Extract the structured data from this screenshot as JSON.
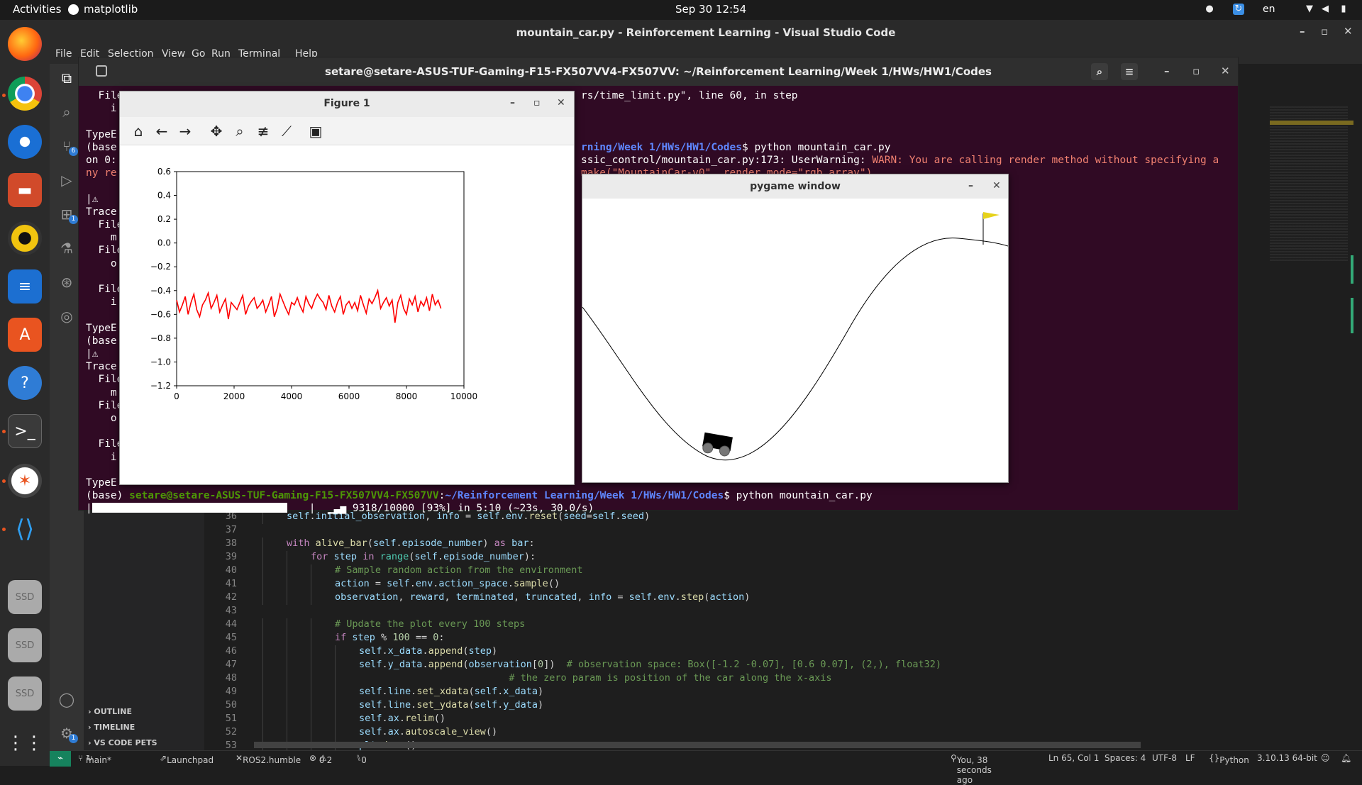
{
  "topbar": {
    "activities": "Activities",
    "app": "matplotlib",
    "clock": "Sep 30  12:54",
    "lang": "en"
  },
  "vscode": {
    "title": "mountain_car.py - Reinforcement Learning - Visual Studio Code",
    "menu": [
      "File",
      "Edit",
      "Selection",
      "View",
      "Go",
      "Run",
      "Terminal",
      "Help"
    ],
    "sidebar": {
      "outline": "OUTLINE",
      "timeline": "TIMELINE",
      "pets": "VS CODE PETS"
    },
    "badges": {
      "scm": "6",
      "ext": "1",
      "settings": "1"
    },
    "lines": [
      {
        "n": "36",
        "indent": 1,
        "html": "<span class='sf'>self</span>.<span class='sf'>initial_observation</span>, <span class='sf'>info</span> = <span class='sf'>self</span>.<span class='sf'>env</span>.<span class='fn'>reset</span>(<span class='sf'>seed</span>=<span class='sf'>self</span>.<span class='sf'>seed</span>)"
      },
      {
        "n": "37",
        "indent": 0,
        "html": ""
      },
      {
        "n": "38",
        "indent": 1,
        "html": "<span class='kw'>with</span> <span class='fn'>alive_bar</span>(<span class='sf'>self</span>.<span class='sf'>episode_number</span>) <span class='kw'>as</span> <span class='sf'>bar</span>:"
      },
      {
        "n": "39",
        "indent": 2,
        "html": "<span class='kw'>for</span> <span class='sf'>step</span> <span class='kw'>in</span> <span class='bt'>range</span>(<span class='sf'>self</span>.<span class='sf'>episode_number</span>):"
      },
      {
        "n": "40",
        "indent": 3,
        "html": "<span class='cm'># Sample random action from the environment</span>"
      },
      {
        "n": "41",
        "indent": 3,
        "html": "<span class='sf'>action</span> = <span class='sf'>self</span>.<span class='sf'>env</span>.<span class='sf'>action_space</span>.<span class='fn'>sample</span>()"
      },
      {
        "n": "42",
        "indent": 3,
        "html": "<span class='sf'>observation</span>, <span class='sf'>reward</span>, <span class='sf'>terminated</span>, <span class='sf'>truncated</span>, <span class='sf'>info</span> = <span class='sf'>self</span>.<span class='sf'>env</span>.<span class='fn'>step</span>(<span class='sf'>action</span>)"
      },
      {
        "n": "43",
        "indent": 0,
        "html": ""
      },
      {
        "n": "44",
        "indent": 3,
        "html": "<span class='cm'># Update the plot every 100 steps</span>"
      },
      {
        "n": "45",
        "indent": 3,
        "html": "<span class='kw'>if</span> <span class='sf'>step</span> % <span class='nm'>100</span> == <span class='nm'>0</span>:"
      },
      {
        "n": "46",
        "indent": 4,
        "html": "<span class='sf'>self</span>.<span class='sf'>x_data</span>.<span class='fn'>append</span>(<span class='sf'>step</span>)"
      },
      {
        "n": "47",
        "indent": 4,
        "html": "<span class='sf'>self</span>.<span class='sf'>y_data</span>.<span class='fn'>append</span>(<span class='sf'>observation</span>[<span class='nm'>0</span>])  <span class='cm'># observation space: Box([-1.2 -0.07], [0.6 0.07], (2,), float32)</span>"
      },
      {
        "n": "48",
        "indent": 4,
        "html": "                          <span class='cm'># the zero param is position of the car along the x-axis</span>"
      },
      {
        "n": "49",
        "indent": 4,
        "html": "<span class='sf'>self</span>.<span class='sf'>line</span>.<span class='fn'>set_xdata</span>(<span class='sf'>self</span>.<span class='sf'>x_data</span>)"
      },
      {
        "n": "50",
        "indent": 4,
        "html": "<span class='sf'>self</span>.<span class='sf'>line</span>.<span class='fn'>set_ydata</span>(<span class='sf'>self</span>.<span class='sf'>y_data</span>)"
      },
      {
        "n": "51",
        "indent": 4,
        "html": "<span class='sf'>self</span>.<span class='sf'>ax</span>.<span class='fn'>relim</span>()"
      },
      {
        "n": "52",
        "indent": 4,
        "html": "<span class='sf'>self</span>.<span class='sf'>ax</span>.<span class='fn'>autoscale_view</span>()"
      },
      {
        "n": "53",
        "indent": 4,
        "html": "<span class='sf'>plt</span>.<span class='fn'>draw</span>()"
      }
    ],
    "status": {
      "branch": "main*",
      "launchpad": "Launchpad",
      "ros": "ROS2.humble",
      "errors": "0",
      "warnings": "2",
      "ports": "0",
      "blame": "You, 38 seconds ago",
      "pos": "Ln 65, Col 1",
      "spaces": "Spaces: 4",
      "enc": "UTF-8",
      "eol": "LF",
      "lang": "Python",
      "interp": "3.10.13 64-bit"
    }
  },
  "terminal": {
    "title": "setare@setare-ASUS-TUF-Gaming-F15-FX507VV4-FX507VV: ~/Reinforcement Learning/Week 1/HWs/HW1/Codes",
    "lines": [
      {
        "t": "  File",
        "right": "rs/time_limit.py\", line 60, in step"
      },
      {
        "t": "    i",
        "right": ""
      },
      {
        "t": "",
        "right": ""
      },
      {
        "t": "TypeE",
        "right": ""
      },
      {
        "t": "(base",
        "right": "<span class='path'>rning/Week 1/HWs/HW1/Codes</span>$ python mountain_car.py"
      },
      {
        "t": "on 0:",
        "right": "ssic_control/mountain_car.py:173: UserWarning: <span class='warn'>WARN: You are calling render method without specifying a</span>"
      },
      {
        "t": "<span class='warn'>ny re</span>",
        "right": "<span class='warn'>make(\"MountainCar-v0\", render_mode=\"rgb_array\")</span>"
      },
      {
        "t": "",
        "right": ""
      },
      {
        "t": "|⚠",
        "right": ""
      },
      {
        "t": "Trace",
        "right": ""
      },
      {
        "t": "  File",
        "right": ""
      },
      {
        "t": "    m",
        "right": ""
      },
      {
        "t": "  File",
        "right": ""
      },
      {
        "t": "    o",
        "right": ""
      },
      {
        "t": "",
        "right": ""
      },
      {
        "t": "  File",
        "right": ""
      },
      {
        "t": "    i",
        "right": ""
      },
      {
        "t": "",
        "right": ""
      },
      {
        "t": "TypeE",
        "right": ""
      },
      {
        "t": "(base",
        "right": ""
      },
      {
        "t": "|⚠",
        "right": ""
      },
      {
        "t": "Trace",
        "right": ""
      },
      {
        "t": "  File",
        "right": ""
      },
      {
        "t": "    m",
        "right": ""
      },
      {
        "t": "  File",
        "right": ""
      },
      {
        "t": "    o",
        "right": ""
      },
      {
        "t": "",
        "right": ""
      },
      {
        "t": "  File",
        "right": ""
      },
      {
        "t": "    i",
        "right": ""
      },
      {
        "t": "",
        "right": ""
      },
      {
        "t": "TypeE",
        "right": ""
      }
    ],
    "prompt_base": "(base) ",
    "prompt_host": "setare@setare-ASUS-TUF-Gaming-F15-FX507VV4-FX507VV",
    "prompt_path": "~/Reinforcement Learning/Week 1/HWs/HW1/Codes",
    "prompt_cmd": "$ python mountain_car.py",
    "progress_text": "|  ▁▃▅ 9318/10000 [93%] in 5:10 (~23s, 30.0/s)",
    "progress_fraction": 0.93
  },
  "figure": {
    "title": "Figure 1"
  },
  "pygame": {
    "title": "pygame window"
  },
  "chart_data": {
    "type": "line",
    "title": "",
    "xlabel": "",
    "ylabel": "",
    "xlim": [
      0,
      10000
    ],
    "ylim": [
      -1.2,
      0.6
    ],
    "xticks": [
      "0",
      "2000",
      "4000",
      "6000",
      "8000",
      "10000"
    ],
    "yticks": [
      "0.6",
      "0.4",
      "0.2",
      "0.0",
      "−0.2",
      "−0.4",
      "−0.6",
      "−0.8",
      "−1.0",
      "−1.2"
    ],
    "grid": false,
    "color": "#ff0000",
    "x": [
      0,
      100,
      200,
      300,
      400,
      500,
      600,
      700,
      800,
      900,
      1000,
      1100,
      1200,
      1300,
      1400,
      1500,
      1600,
      1700,
      1800,
      1900,
      2000,
      2100,
      2200,
      2300,
      2400,
      2500,
      2600,
      2700,
      2800,
      2900,
      3000,
      3100,
      3200,
      3300,
      3400,
      3500,
      3600,
      3700,
      3800,
      3900,
      4000,
      4100,
      4200,
      4300,
      4400,
      4500,
      4600,
      4700,
      4800,
      4900,
      5000,
      5100,
      5200,
      5300,
      5400,
      5500,
      5600,
      5700,
      5800,
      5900,
      6000,
      6100,
      6200,
      6300,
      6400,
      6500,
      6600,
      6700,
      6800,
      6900,
      7000,
      7100,
      7200,
      7300,
      7400,
      7500,
      7600,
      7700,
      7800,
      7900,
      8000,
      8100,
      8200,
      8300,
      8400,
      8500,
      8600,
      8700,
      8800,
      8900,
      9000,
      9100,
      9200
    ],
    "y": [
      -0.48,
      -0.58,
      -0.52,
      -0.45,
      -0.6,
      -0.5,
      -0.43,
      -0.56,
      -0.62,
      -0.52,
      -0.48,
      -0.42,
      -0.55,
      -0.5,
      -0.44,
      -0.58,
      -0.52,
      -0.47,
      -0.64,
      -0.5,
      -0.53,
      -0.56,
      -0.5,
      -0.44,
      -0.6,
      -0.53,
      -0.49,
      -0.46,
      -0.55,
      -0.52,
      -0.48,
      -0.58,
      -0.52,
      -0.45,
      -0.62,
      -0.55,
      -0.43,
      -0.49,
      -0.55,
      -0.6,
      -0.5,
      -0.52,
      -0.46,
      -0.53,
      -0.58,
      -0.45,
      -0.51,
      -0.55,
      -0.48,
      -0.43,
      -0.47,
      -0.5,
      -0.56,
      -0.44,
      -0.53,
      -0.58,
      -0.5,
      -0.45,
      -0.6,
      -0.52,
      -0.49,
      -0.55,
      -0.5,
      -0.57,
      -0.44,
      -0.52,
      -0.59,
      -0.47,
      -0.51,
      -0.46,
      -0.4,
      -0.55,
      -0.5,
      -0.46,
      -0.53,
      -0.48,
      -0.67,
      -0.5,
      -0.44,
      -0.55,
      -0.6,
      -0.47,
      -0.52,
      -0.45,
      -0.58,
      -0.49,
      -0.53,
      -0.46,
      -0.57,
      -0.43,
      -0.52,
      -0.48,
      -0.55
    ]
  }
}
